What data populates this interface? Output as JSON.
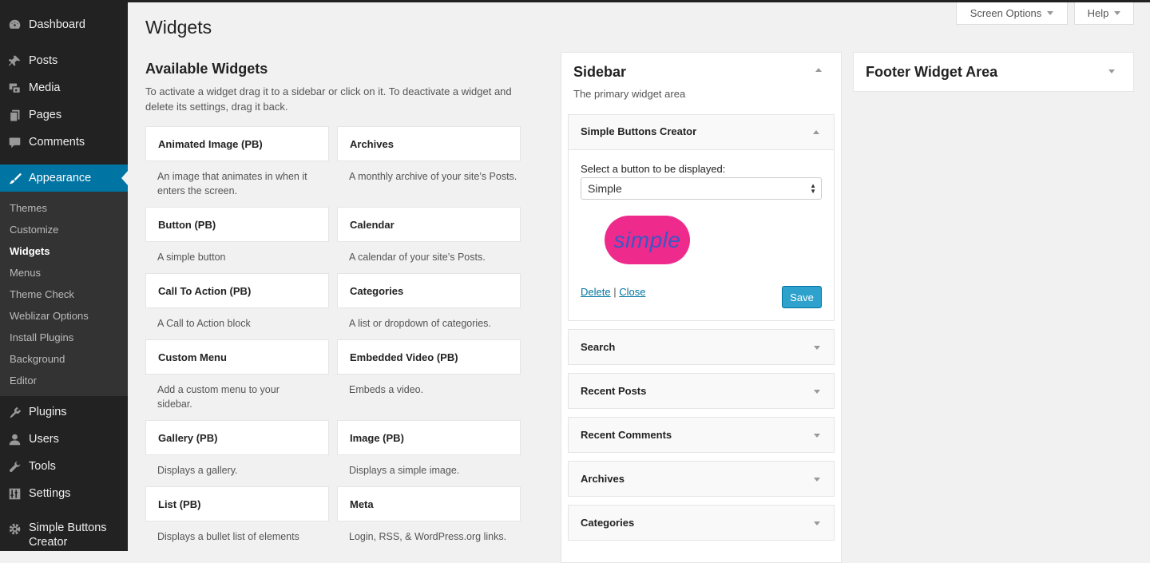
{
  "admin_menu": {
    "top_items": [
      {
        "label": "Dashboard",
        "icon": "dashboard-icon"
      },
      {
        "label": "Posts",
        "icon": "pin-icon"
      },
      {
        "label": "Media",
        "icon": "media-icon"
      },
      {
        "label": "Pages",
        "icon": "pages-icon"
      },
      {
        "label": "Comments",
        "icon": "comment-icon"
      },
      {
        "label": "Appearance",
        "icon": "brush-icon"
      }
    ],
    "submenu": [
      "Themes",
      "Customize",
      "Widgets",
      "Menus",
      "Theme Check",
      "Weblizar Options",
      "Install Plugins",
      "Background",
      "Editor"
    ],
    "bottom_items": [
      {
        "label": "Plugins",
        "icon": "plugin-icon"
      },
      {
        "label": "Users",
        "icon": "user-icon"
      },
      {
        "label": "Tools",
        "icon": "wrench-icon"
      },
      {
        "label": "Settings",
        "icon": "settings-icon"
      },
      {
        "label": "Simple Buttons Creator",
        "icon": "gear-icon"
      }
    ]
  },
  "header": {
    "screen_options": "Screen Options",
    "help": "Help",
    "page_title": "Widgets"
  },
  "available": {
    "title": "Available Widgets",
    "description": "To activate a widget drag it to a sidebar or click on it. To deactivate a widget and delete its settings, drag it back.",
    "widgets": [
      {
        "name": "Animated Image (PB)",
        "desc": "An image that animates in when it enters the screen."
      },
      {
        "name": "Archives",
        "desc": "A monthly archive of your site’s Posts."
      },
      {
        "name": "Button (PB)",
        "desc": "A simple button"
      },
      {
        "name": "Calendar",
        "desc": "A calendar of your site’s Posts."
      },
      {
        "name": "Call To Action (PB)",
        "desc": "A Call to Action block"
      },
      {
        "name": "Categories",
        "desc": "A list or dropdown of categories."
      },
      {
        "name": "Custom Menu",
        "desc": "Add a custom menu to your sidebar."
      },
      {
        "name": "Embedded Video (PB)",
        "desc": "Embeds a video."
      },
      {
        "name": "Gallery (PB)",
        "desc": "Displays a gallery."
      },
      {
        "name": "Image (PB)",
        "desc": "Displays a simple image."
      },
      {
        "name": "List (PB)",
        "desc": "Displays a bullet list of elements"
      },
      {
        "name": "Meta",
        "desc": "Login, RSS, & WordPress.org links."
      }
    ]
  },
  "sidebar_area": {
    "title": "Sidebar",
    "description": "The primary widget area",
    "open_widget": {
      "title": "Simple Buttons Creator",
      "select_label": "Select a button to be displayed:",
      "select_value": "Simple",
      "preview_text": "simple",
      "preview_bg": "#ee2b8c",
      "preview_text_color": "#3b57c4",
      "delete_link": "Delete",
      "separator": "|",
      "close_link": "Close",
      "save_label": "Save"
    },
    "widgets": [
      "Search",
      "Recent Posts",
      "Recent Comments",
      "Archives",
      "Categories"
    ]
  },
  "footer_area": {
    "title": "Footer Widget Area"
  },
  "colors": {
    "admin_bg": "#222222",
    "active_menu": "#0074a2",
    "save_button": "#2ea2cc"
  }
}
